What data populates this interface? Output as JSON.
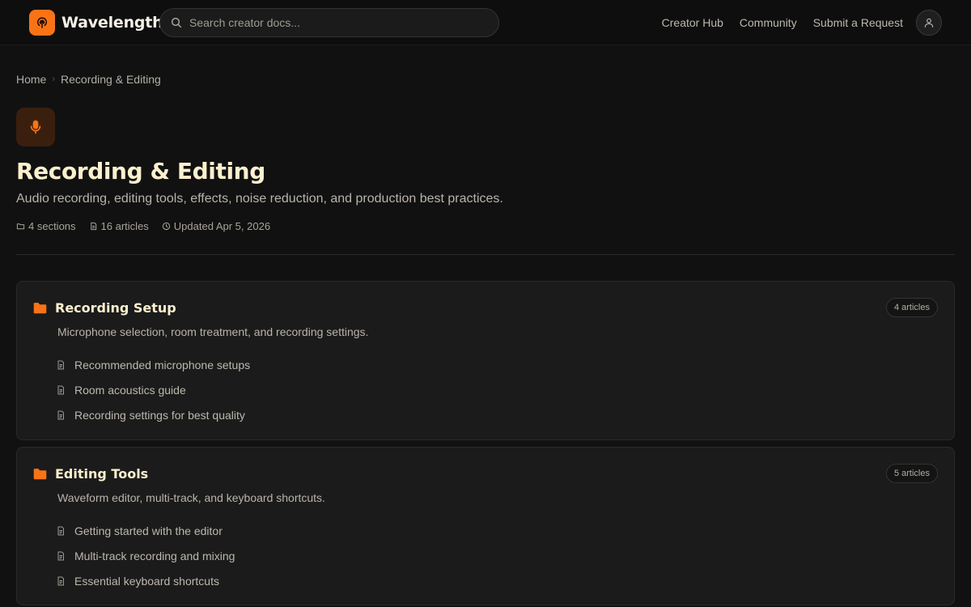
{
  "header": {
    "brand_name": "Wavelength",
    "brand_color": "#f97316",
    "search_placeholder": "Search creator docs...",
    "nav": [
      {
        "label": "Creator Hub"
      },
      {
        "label": "Community"
      },
      {
        "label": "Submit a Request"
      }
    ],
    "avatar_icon": "user-icon"
  },
  "breadcrumb": [
    {
      "label": "Home"
    },
    {
      "label": "Recording & Editing"
    }
  ],
  "category": {
    "icon": "microphone-icon",
    "title": "Recording & Editing",
    "description": "Audio recording, editing tools, effects, noise reduction, and production best practices.",
    "meta": {
      "sections": "4 sections",
      "articles": "16 articles",
      "updated": "Updated Apr 5, 2026"
    }
  },
  "sections": [
    {
      "title": "Recording Setup",
      "badge": "4 articles",
      "description": "Microphone selection, room treatment, and recording settings.",
      "articles": [
        {
          "title": "Recommended microphone setups"
        },
        {
          "title": "Room acoustics guide"
        },
        {
          "title": "Recording settings for best quality"
        }
      ]
    },
    {
      "title": "Editing Tools",
      "badge": "5 articles",
      "description": "Waveform editor, multi-track, and keyboard shortcuts.",
      "articles": [
        {
          "title": "Getting started with the editor"
        },
        {
          "title": "Multi-track recording and mixing"
        },
        {
          "title": "Essential keyboard shortcuts"
        }
      ]
    }
  ],
  "colors": {
    "accent": "#f97316",
    "title": "#fdf0cf",
    "background": "#111111",
    "card": "#1b1b1b"
  }
}
